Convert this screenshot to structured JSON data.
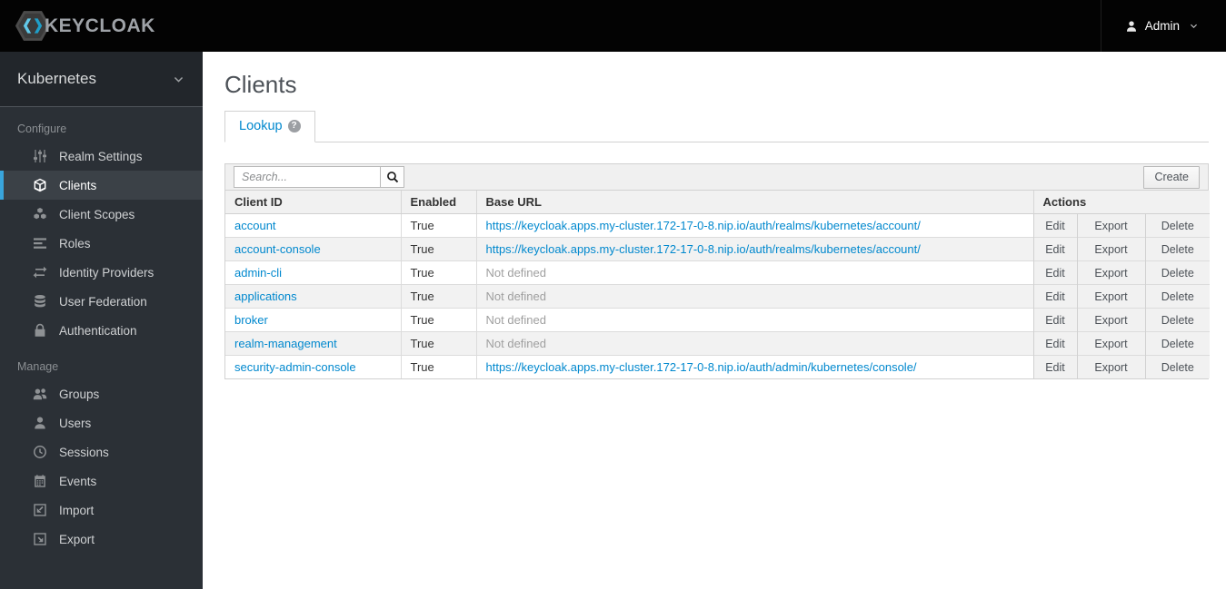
{
  "topbar": {
    "brand": "KEYCLOAK",
    "user_label": "Admin"
  },
  "sidebar": {
    "realm": "Kubernetes",
    "sections": [
      {
        "label": "Configure",
        "items": [
          {
            "label": "Realm Settings",
            "icon": "sliders-icon",
            "active": false
          },
          {
            "label": "Clients",
            "icon": "cube-icon",
            "active": true
          },
          {
            "label": "Client Scopes",
            "icon": "cubes-icon",
            "active": false
          },
          {
            "label": "Roles",
            "icon": "list-icon",
            "active": false
          },
          {
            "label": "Identity Providers",
            "icon": "exchange-icon",
            "active": false
          },
          {
            "label": "User Federation",
            "icon": "database-icon",
            "active": false
          },
          {
            "label": "Authentication",
            "icon": "lock-icon",
            "active": false
          }
        ]
      },
      {
        "label": "Manage",
        "items": [
          {
            "label": "Groups",
            "icon": "users-icon",
            "active": false
          },
          {
            "label": "Users",
            "icon": "user-icon",
            "active": false
          },
          {
            "label": "Sessions",
            "icon": "clock-icon",
            "active": false
          },
          {
            "label": "Events",
            "icon": "calendar-icon",
            "active": false
          },
          {
            "label": "Import",
            "icon": "import-icon",
            "active": false
          },
          {
            "label": "Export",
            "icon": "export-icon",
            "active": false
          }
        ]
      }
    ]
  },
  "main": {
    "title": "Clients",
    "tab_label": "Lookup",
    "toolbar": {
      "search_placeholder": "Search...",
      "create_label": "Create"
    },
    "table": {
      "headers": {
        "client_id": "Client ID",
        "enabled": "Enabled",
        "base_url": "Base URL",
        "actions": "Actions"
      },
      "action_labels": {
        "edit": "Edit",
        "export": "Export",
        "delete": "Delete"
      },
      "rows": [
        {
          "client_id": "account",
          "enabled": "True",
          "base_url": "https://keycloak.apps.my-cluster.172-17-0-8.nip.io/auth/realms/kubernetes/account/",
          "base_url_defined": true
        },
        {
          "client_id": "account-console",
          "enabled": "True",
          "base_url": "https://keycloak.apps.my-cluster.172-17-0-8.nip.io/auth/realms/kubernetes/account/",
          "base_url_defined": true
        },
        {
          "client_id": "admin-cli",
          "enabled": "True",
          "base_url": "Not defined",
          "base_url_defined": false
        },
        {
          "client_id": "applications",
          "enabled": "True",
          "base_url": "Not defined",
          "base_url_defined": false
        },
        {
          "client_id": "broker",
          "enabled": "True",
          "base_url": "Not defined",
          "base_url_defined": false
        },
        {
          "client_id": "realm-management",
          "enabled": "True",
          "base_url": "Not defined",
          "base_url_defined": false
        },
        {
          "client_id": "security-admin-console",
          "enabled": "True",
          "base_url": "https://keycloak.apps.my-cluster.172-17-0-8.nip.io/auth/admin/kubernetes/console/",
          "base_url_defined": true
        }
      ]
    }
  },
  "colors": {
    "topbar_bg": "#030303",
    "sidebar_bg": "#2b3036",
    "realm_selector_bg": "#22262b",
    "active_item_bg": "#3b4147",
    "active_indicator": "#39a5dc",
    "link": "#0088ce",
    "muted_text": "#9f9f9f",
    "table_header_bg": "#f1f1f1",
    "stripe_bg": "#f2f2f2"
  }
}
